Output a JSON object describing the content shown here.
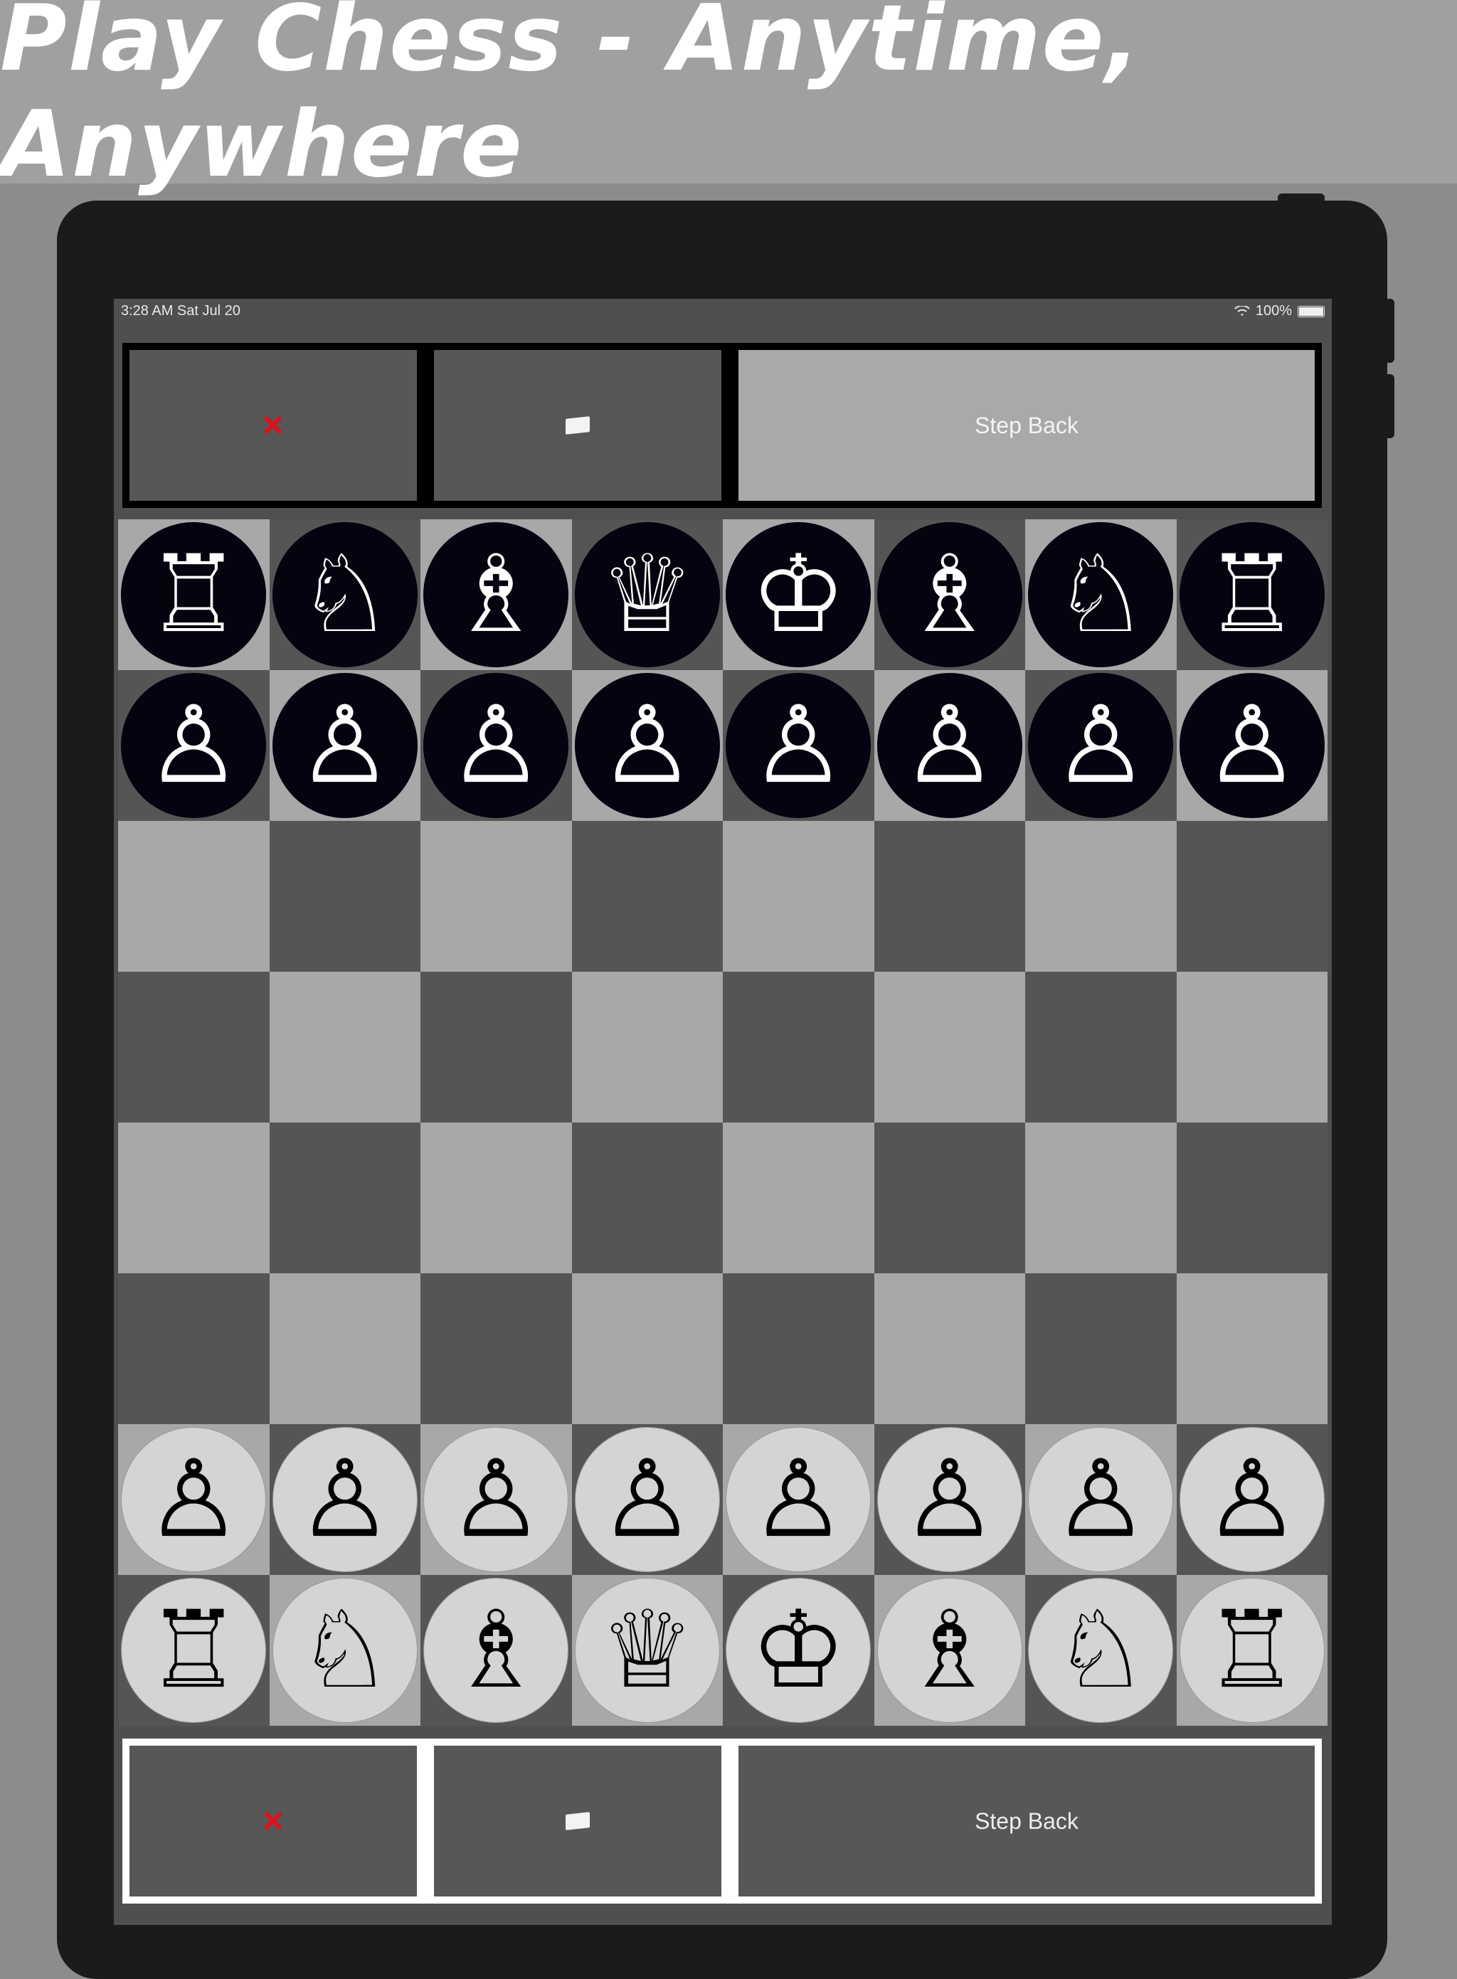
{
  "headline": "Play Chess - Anytime, Anywhere",
  "status_bar": {
    "time": "3:28 AM   Sat Jul 20",
    "battery": "100%",
    "wifi_icon": "wifi-icon"
  },
  "top_controls": {
    "close_icon": "×",
    "flag_icon": "flag-icon",
    "step_back": "Step Back"
  },
  "bottom_controls": {
    "close_icon": "×",
    "flag_icon": "flag-icon",
    "step_back": "Step Back"
  },
  "colors": {
    "close": "#e0101a",
    "light_square": "#a8a8a8",
    "dark_square": "#555555",
    "black_piece_bg": "#04030f",
    "white_piece_bg": "#d4d4d4"
  },
  "board": {
    "first_square": "light",
    "rows": [
      [
        "♖",
        "♘",
        "♗",
        "♕",
        "♔",
        "♗",
        "♘",
        "♖"
      ],
      [
        "♙",
        "♙",
        "♙",
        "♙",
        "♙",
        "♙",
        "♙",
        "♙"
      ],
      [
        "",
        "",
        "",
        "",
        "",
        "",
        "",
        ""
      ],
      [
        "",
        "",
        "",
        "",
        "",
        "",
        "",
        ""
      ],
      [
        "",
        "",
        "",
        "",
        "",
        "",
        "",
        ""
      ],
      [
        "",
        "",
        "",
        "",
        "",
        "",
        "",
        ""
      ],
      [
        "♙",
        "♙",
        "♙",
        "♙",
        "♙",
        "♙",
        "♙",
        "♙"
      ],
      [
        "♖",
        "♘",
        "♗",
        "♕",
        "♔",
        "♗",
        "♘",
        "♖"
      ]
    ],
    "row_side": [
      "black",
      "black",
      "",
      "",
      "",
      "",
      "white",
      "white"
    ],
    "piece_names": {
      "♖": "rook",
      "♘": "knight",
      "♗": "bishop",
      "♕": "queen",
      "♔": "king",
      "♙": "pawn"
    }
  }
}
